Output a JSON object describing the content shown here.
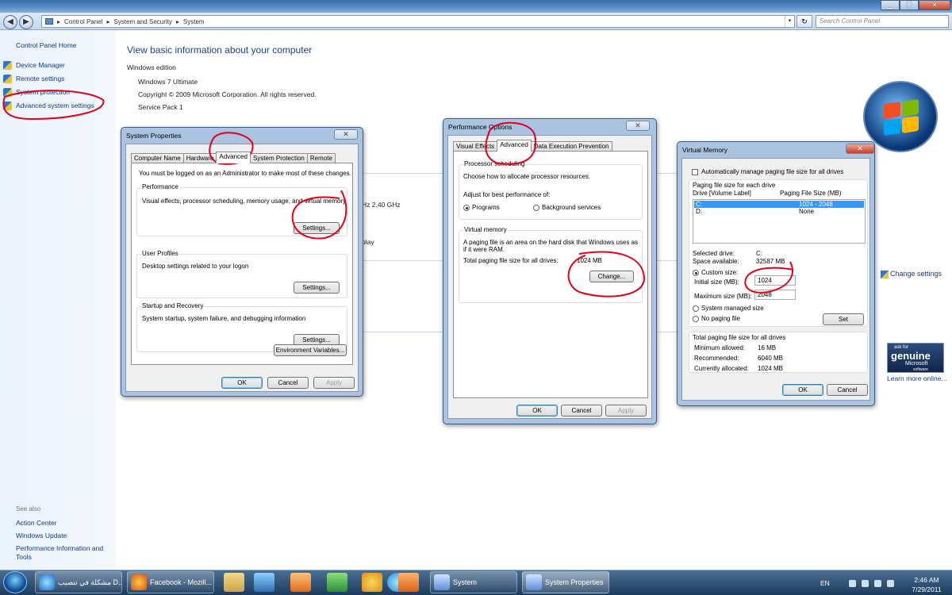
{
  "explorer": {
    "address": [
      "Control Panel",
      "System and Security",
      "System"
    ],
    "search_placeholder": "Search Control Panel",
    "left_pane": {
      "home": "Control Panel Home",
      "links": [
        "Device Manager",
        "Remote settings",
        "System protection",
        "Advanced system settings"
      ],
      "see_also_heading": "See also",
      "see_also": [
        "Action Center",
        "Windows Update",
        "Performance Information and",
        "Tools"
      ]
    },
    "main": {
      "title": "View basic information about your computer",
      "edition_heading": "Windows edition",
      "edition": "Windows 7 Ultimate",
      "copyright": "Copyright © 2009 Microsoft Corporation.  All rights reserved.",
      "service_pack": "Service Pack 1",
      "cpu_fragment": "Hz  2.40 GHz",
      "display_fragment": "play",
      "change_settings": "Change settings",
      "genuine": {
        "line1": "ask for",
        "line2": "genuine",
        "line3": "Microsoft",
        "line4": "software"
      },
      "learn_more": "Learn more online..."
    }
  },
  "system_properties": {
    "title": "System Properties",
    "tabs": [
      "Computer Name",
      "Hardware",
      "Advanced",
      "System Protection",
      "Remote"
    ],
    "active_tab": "Advanced",
    "admin_note": "You must be logged on as an Administrator to make most of these changes.",
    "performance": {
      "label": "Performance",
      "desc": "Visual effects, processor scheduling, memory usage, and virtual memory",
      "button": "Settings..."
    },
    "user_profiles": {
      "label": "User Profiles",
      "desc": "Desktop settings related to your logon",
      "button": "Settings..."
    },
    "startup": {
      "label": "Startup and Recovery",
      "desc": "System startup, system failure, and debugging information",
      "button": "Settings..."
    },
    "env_button": "Environment Variables...",
    "ok": "OK",
    "cancel": "Cancel",
    "apply": "Apply"
  },
  "performance_options": {
    "title": "Performance Options",
    "tabs": [
      "Visual Effects",
      "Advanced",
      "Data Execution Prevention"
    ],
    "active_tab": "Advanced",
    "scheduling": {
      "label": "Processor scheduling",
      "desc": "Choose how to allocate processor resources.",
      "adjust": "Adjust for best performance of:",
      "opt1": "Programs",
      "opt2": "Background services"
    },
    "vm": {
      "label": "Virtual memory",
      "desc1": "A paging file is an area on the hard disk that Windows uses as",
      "desc2": "if it were RAM.",
      "total_label": "Total paging file size for all drives:",
      "total_value": "1024 MB",
      "button": "Change..."
    },
    "ok": "OK",
    "cancel": "Cancel",
    "apply": "Apply"
  },
  "virtual_memory": {
    "title": "Virtual Memory",
    "auto_manage": "Automatically manage paging file size for all drives",
    "each_drive": "Paging file size for each drive",
    "col_drive": "Drive  [Volume Label]",
    "col_size": "Paging File Size (MB)",
    "drives": [
      {
        "drive": "C:",
        "size": "1024 - 2048"
      },
      {
        "drive": "D:",
        "size": "None"
      }
    ],
    "selected_drive_label": "Selected drive:",
    "selected_drive": "C:",
    "space_label": "Space available:",
    "space": "32587 MB",
    "custom_size": "Custom size:",
    "initial_label": "Initial size (MB):",
    "initial_value": "1024",
    "max_label": "Maximum size (MB):",
    "max_value": "2048",
    "system_managed": "System managed size",
    "no_paging": "No paging file",
    "set_button": "Set",
    "total_heading": "Total paging file size for all drives",
    "min_label": "Minimum allowed:",
    "min_value": "16 MB",
    "rec_label": "Recommended:",
    "rec_value": "6040 MB",
    "cur_label": "Currently allocated:",
    "cur_value": "1024 MB",
    "ok": "OK",
    "cancel": "Cancel"
  },
  "taskbar": {
    "buttons": [
      "مشكلة في تنصيب D...",
      "Facebook - Mozill...",
      "System",
      "System Properties"
    ],
    "lang": "EN",
    "time": "2:46 AM",
    "date": "7/29/2011"
  },
  "colors": {
    "annotation_red": "#e3001b",
    "link_blue": "#0b3c8c",
    "title_blue": "#1e3f8d"
  }
}
